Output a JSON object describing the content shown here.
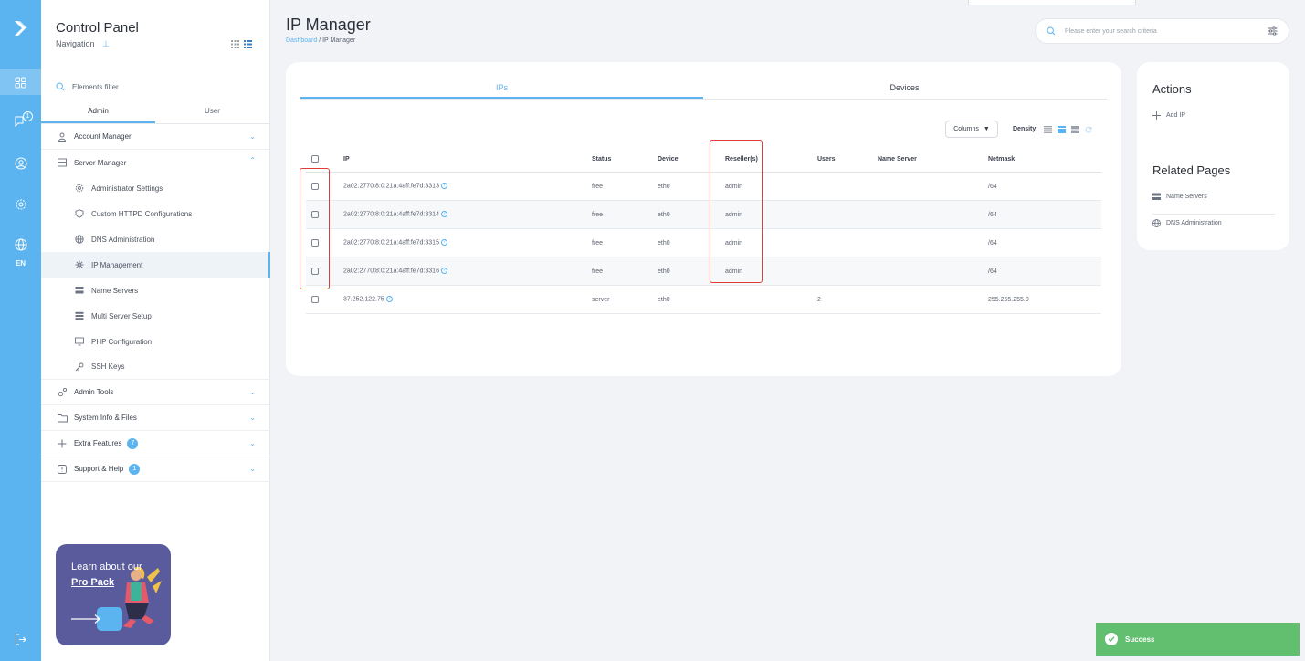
{
  "sidebar": {
    "title": "Control Panel",
    "subtitle": "Navigation",
    "filter_placeholder": "Elements filter",
    "tabs": [
      {
        "label": "Admin"
      },
      {
        "label": "User"
      }
    ],
    "language": "EN",
    "message_count": "1",
    "menu": {
      "account_manager": "Account Manager",
      "server_manager": "Server Manager",
      "admin_settings": "Administrator Settings",
      "custom_httpd": "Custom HTTPD Configurations",
      "dns_admin": "DNS Administration",
      "ip_management": "IP Management",
      "name_servers": "Name Servers",
      "multi_server": "Multi Server Setup",
      "php_config": "PHP Configuration",
      "ssh_keys": "SSH Keys",
      "admin_tools": "Admin Tools",
      "system_info": "System Info & Files",
      "extra_features": "Extra Features",
      "extra_count": "7",
      "support": "Support & Help",
      "support_count": "1"
    },
    "promo": {
      "line1": "Learn about our",
      "line2": "Pro Pack"
    }
  },
  "header": {
    "title": "IP Manager",
    "breadcrumb_home": "Dashboard",
    "breadcrumb_sep": " / ",
    "breadcrumb_current": "IP Manager",
    "search_placeholder": "Please enter your search criteria"
  },
  "main": {
    "tabs": [
      {
        "label": "IPs"
      },
      {
        "label": "Devices"
      }
    ],
    "columns_label": "Columns",
    "density_label": "Density:",
    "table": {
      "headers": {
        "ip": "IP",
        "status": "Status",
        "device": "Device",
        "resellers": "Reseller(s)",
        "users": "Users",
        "name_server": "Name Server",
        "netmask": "Netmask"
      },
      "rows": [
        {
          "ip": "2a02:2770:8:0:21a:4aff:fe7d:3313",
          "status": "free",
          "device": "eth0",
          "resellers": "admin",
          "users": "",
          "name_server": "",
          "netmask": "/64"
        },
        {
          "ip": "2a02:2770:8:0:21a:4aff:fe7d:3314",
          "status": "free",
          "device": "eth0",
          "resellers": "admin",
          "users": "",
          "name_server": "",
          "netmask": "/64"
        },
        {
          "ip": "2a02:2770:8:0:21a:4aff:fe7d:3315",
          "status": "free",
          "device": "eth0",
          "resellers": "admin",
          "users": "",
          "name_server": "",
          "netmask": "/64"
        },
        {
          "ip": "2a02:2770:8:0:21a:4aff:fe7d:3316",
          "status": "free",
          "device": "eth0",
          "resellers": "admin",
          "users": "",
          "name_server": "",
          "netmask": "/64"
        },
        {
          "ip": "37.252.122.75",
          "status": "server",
          "device": "eth0",
          "resellers": "",
          "users": "2",
          "name_server": "",
          "netmask": "255.255.255.0"
        }
      ]
    }
  },
  "actions": {
    "title": "Actions",
    "add_ip": "Add IP"
  },
  "related": {
    "title": "Related Pages",
    "items": [
      {
        "label": "Name Servers"
      },
      {
        "label": "DNS Administration"
      }
    ]
  },
  "toast": {
    "message": "Success"
  },
  "colors": {
    "accent": "#5bb4f0",
    "success": "#62bf6f",
    "highlight": "#e03b3b"
  }
}
